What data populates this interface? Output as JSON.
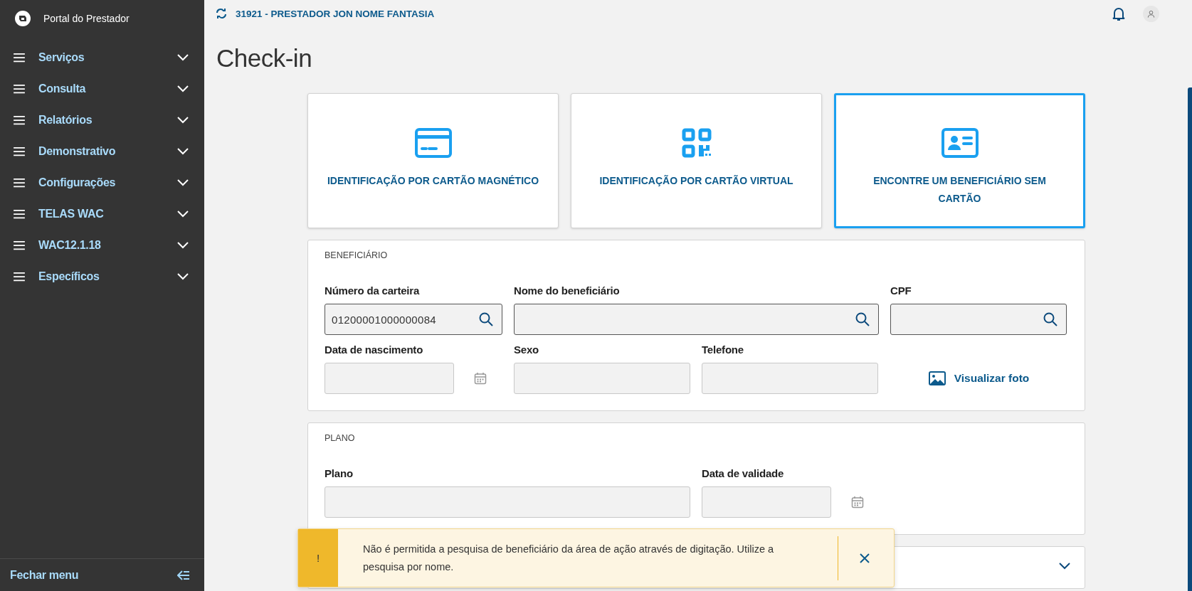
{
  "sidebar": {
    "title": "Portal do Prestador",
    "items": [
      {
        "label": "Serviços",
        "expanded": false
      },
      {
        "label": "Consulta",
        "expanded": false
      },
      {
        "label": "Relatórios",
        "expanded": false
      },
      {
        "label": "Demonstrativo",
        "expanded": false
      },
      {
        "label": "Configurações",
        "expanded": false
      },
      {
        "label": "TELAS WAC",
        "expanded": false
      },
      {
        "label": "WAC12.1.18",
        "expanded": false
      },
      {
        "label": "Específicos",
        "expanded": false
      }
    ],
    "footer": "Fechar menu"
  },
  "header": {
    "provider": "31921 - PRESTADOR JON NOME FANTASIA"
  },
  "page_title": "Check-in",
  "options": [
    {
      "label": "IDENTIFICAÇÃO POR CARTÃO MAGNÉTICO",
      "selected": false
    },
    {
      "label": "IDENTIFICAÇÃO POR CARTÃO VIRTUAL",
      "selected": false
    },
    {
      "label": "ENCONTRE UM BENEFICIÁRIO SEM CARTÃO",
      "selected": true
    }
  ],
  "sections": [
    {
      "title": "BENEFICIÁRIO",
      "rows": [
        [
          {
            "kind": "search",
            "label": "Número da carteira",
            "value": "01200001000000084"
          },
          {
            "kind": "search",
            "label": "Nome do beneficiário"
          },
          {
            "kind": "search",
            "label": "CPF"
          }
        ],
        [
          {
            "kind": "date",
            "label": "Data de nascimento"
          },
          {
            "kind": "text",
            "label": "Sexo"
          },
          {
            "kind": "text",
            "label": "Telefone"
          },
          {
            "kind": "link",
            "label": "Visualizar foto"
          }
        ]
      ]
    },
    {
      "title": "PLANO",
      "rows": [
        [
          {
            "kind": "text",
            "label": "Plano"
          },
          {
            "kind": "date",
            "label": "Data de validade"
          }
        ]
      ]
    }
  ],
  "collapsed_section": {
    "expanded": false
  },
  "toast": {
    "kind": "warning",
    "icon": "!",
    "message": "Não é permitida a pesquisa de beneficiário da área de ação através de digitação. Utilize a pesquisa por nome."
  }
}
